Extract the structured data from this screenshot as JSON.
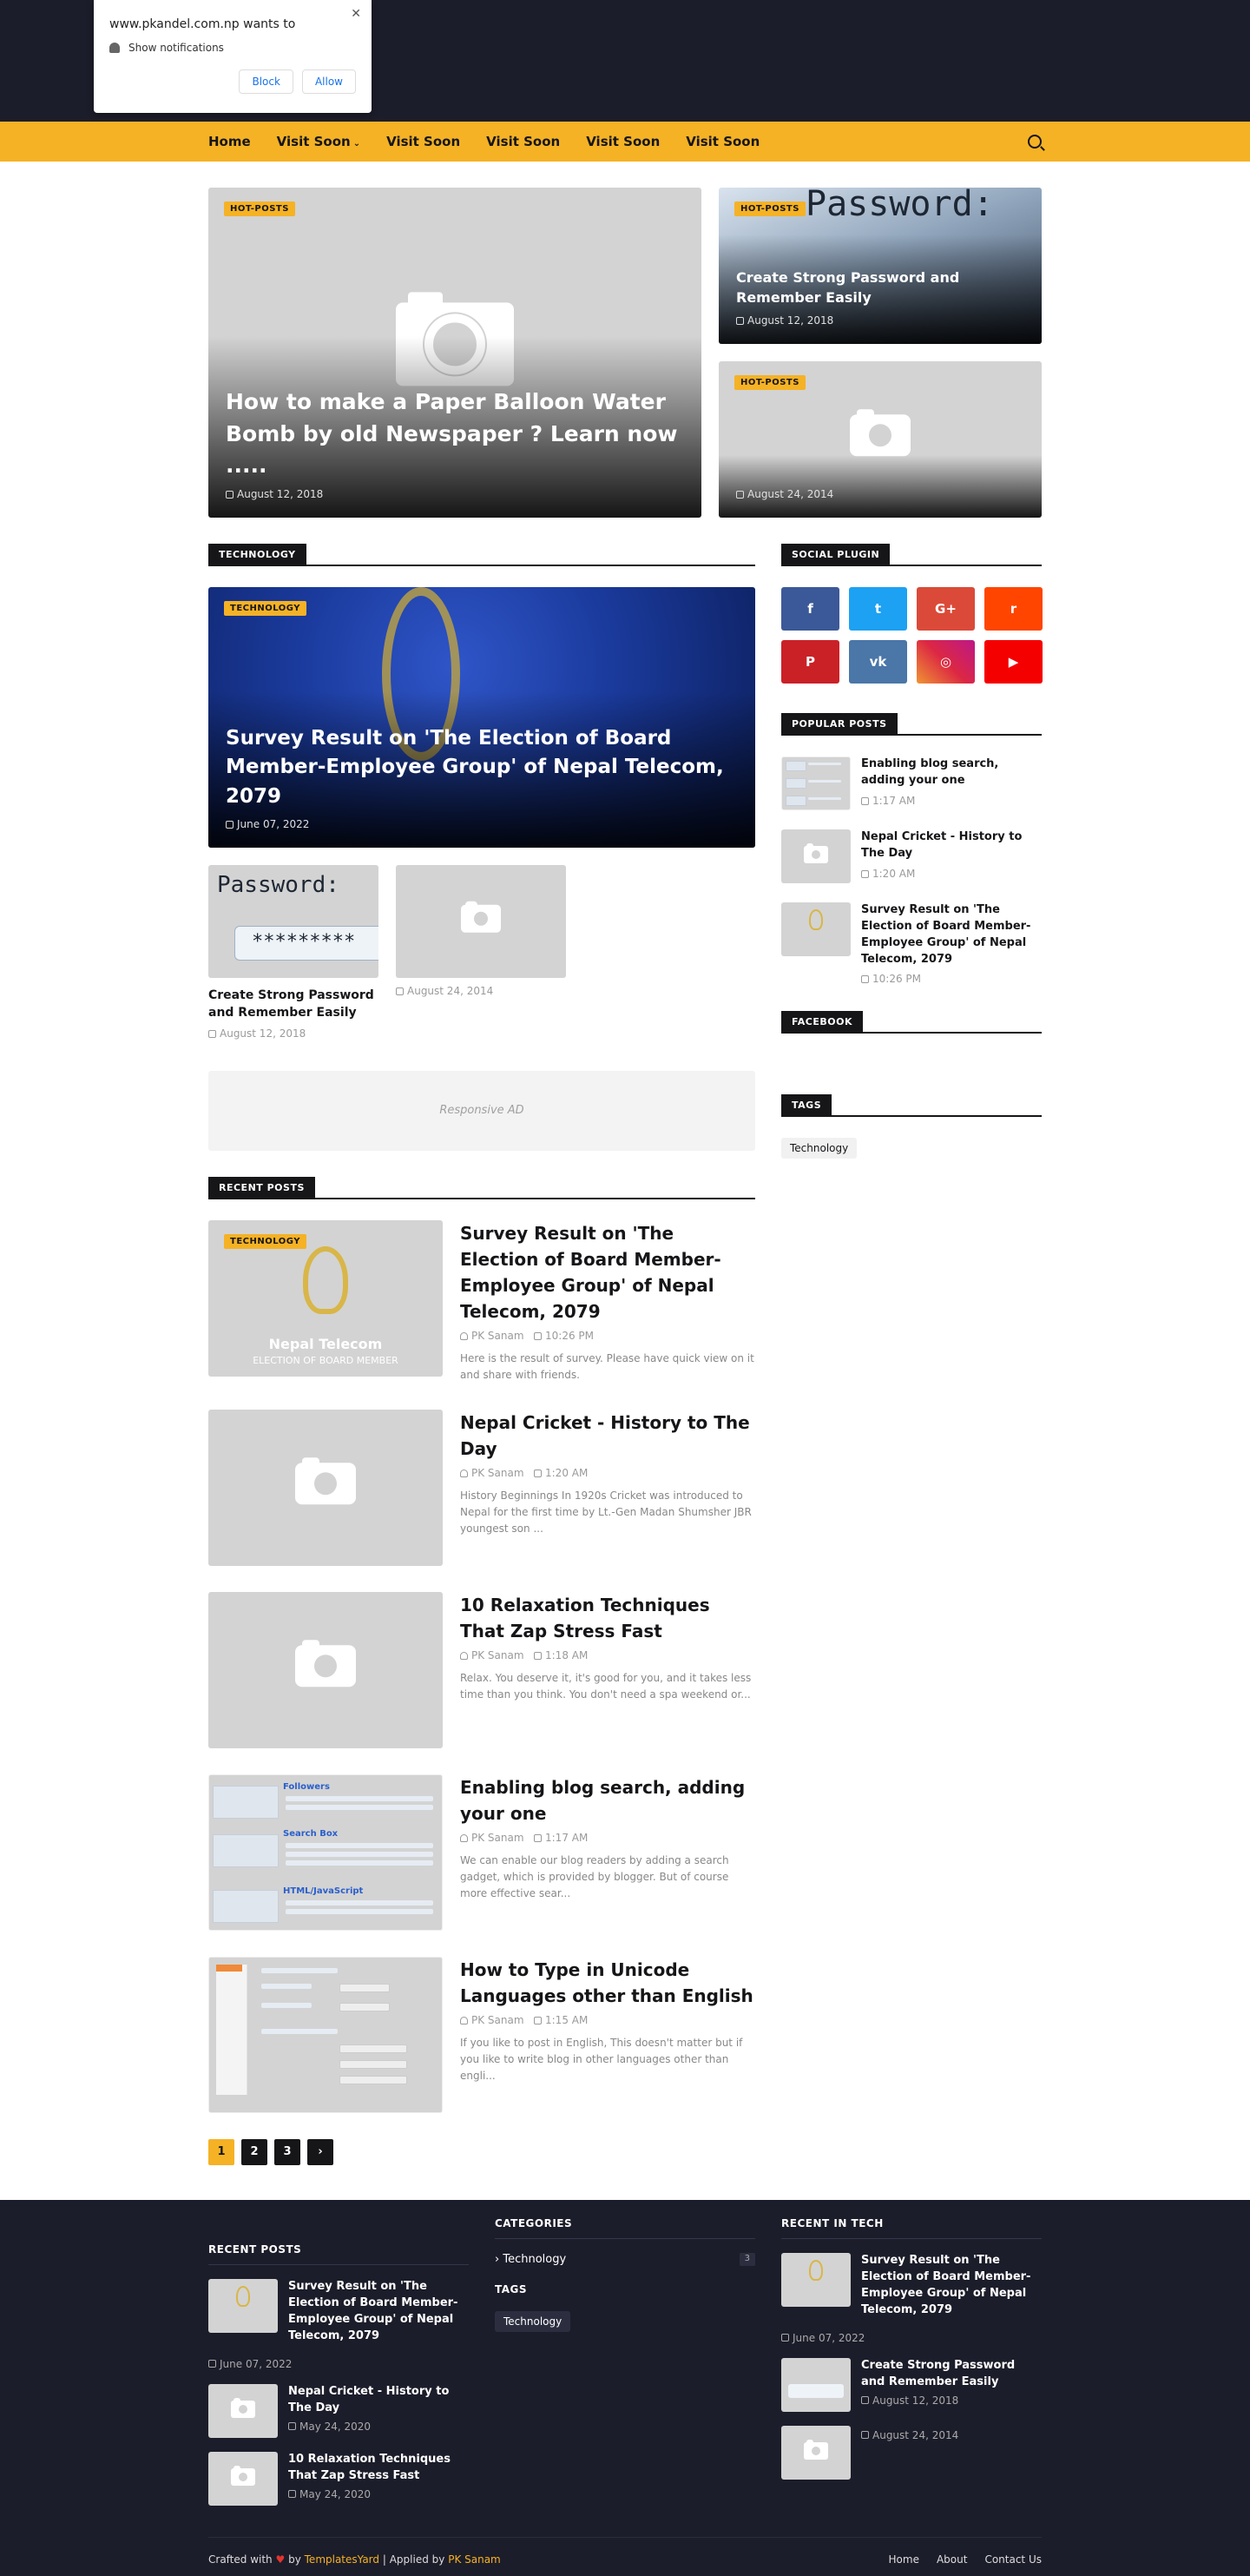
{
  "notification": {
    "site": "www.pkandel.com.np wants to",
    "message": "Show notifications",
    "block": "Block",
    "allow": "Allow"
  },
  "nav": {
    "items": [
      "Home",
      "Visit Soon",
      "Visit Soon",
      "Visit Soon",
      "Visit Soon",
      "Visit Soon"
    ]
  },
  "hot": {
    "badge": "HOT-POSTS",
    "big": {
      "title": "How to make a Paper Balloon Water Bomb by old Newspaper ? Learn now .....",
      "date": "August 12, 2018"
    },
    "small1": {
      "title": "Create Strong Password and Remember Easily",
      "date": "August 12, 2018",
      "bg_text": "Password:"
    },
    "small2": {
      "title": "",
      "date": "August 24, 2014"
    }
  },
  "technology": {
    "section_title": "TECHNOLOGY",
    "badge": "TECHNOLOGY",
    "big": {
      "title": "Survey Result on 'The Election of Board Member-Employee Group' of Nepal Telecom, 2079",
      "date": "June 07, 2022"
    },
    "items": [
      {
        "title": "Create Strong Password and Remember Easily",
        "date": "August 12, 2018",
        "bg_text": "Password:",
        "stars": "*********"
      },
      {
        "title": "",
        "date": "August 24, 2014"
      }
    ]
  },
  "ad": {
    "label": "Responsive AD"
  },
  "recent": {
    "section_title": "RECENT POSTS",
    "badge": "TECHNOLOGY",
    "posts": [
      {
        "title": "Survey Result on 'The Election of Board Member-Employee Group' of Nepal Telecom, 2079",
        "author": "PK Sanam",
        "time": "10:26 PM",
        "excerpt": "Here is the result of survey. Please have quick view on it and share with friends.",
        "thumb_title": "Nepal Telecom",
        "thumb_sub": "ELECTION OF BOARD MEMBER"
      },
      {
        "title": "Nepal Cricket - History to The Day",
        "author": "PK Sanam",
        "time": "1:20 AM",
        "excerpt": "History Beginnings In 1920s Cricket was introduced to Nepal for the first time by Lt.-Gen Madan Shumsher JBR youngest son ..."
      },
      {
        "title": "10 Relaxation Techniques That Zap Stress Fast",
        "author": "PK Sanam",
        "time": "1:18 AM",
        "excerpt": "Relax. You deserve it, it's good for you, and it takes less time than you think. You don't need a spa weekend or..."
      },
      {
        "title": "Enabling blog search, adding your one",
        "author": "PK Sanam",
        "time": "1:17 AM",
        "excerpt": "We can enable our blog readers by adding a search gadget, which is provided by blogger. But of course more effective sear..."
      },
      {
        "title": "How to Type in Unicode Languages other than English",
        "author": "PK Sanam",
        "time": "1:15 AM",
        "excerpt": "If you like to post in English, This doesn't matter but if you like to write blog in other languages other than engli..."
      }
    ],
    "widget_labels": [
      "Followers",
      "Search Box",
      "HTML/JavaScript"
    ]
  },
  "pager": [
    "1",
    "2",
    "3",
    "›"
  ],
  "sidebar": {
    "social_title": "SOCIAL PLUGIN",
    "social": [
      {
        "name": "facebook",
        "glyph": "f",
        "color": "#3b5998"
      },
      {
        "name": "twitter",
        "glyph": "t",
        "color": "#1da1f2"
      },
      {
        "name": "google-plus",
        "glyph": "G+",
        "color": "#db4a39"
      },
      {
        "name": "reddit",
        "glyph": "r",
        "color": "#ff4500"
      },
      {
        "name": "pinterest",
        "glyph": "P",
        "color": "#ca2127"
      },
      {
        "name": "vk",
        "glyph": "vk",
        "color": "#4a76a8"
      },
      {
        "name": "instagram",
        "glyph": "◎",
        "color": "#c13584"
      },
      {
        "name": "youtube",
        "glyph": "▶",
        "color": "#f50000"
      }
    ],
    "popular_title": "POPULAR POSTS",
    "popular": [
      {
        "title": "Enabling blog search, adding your one",
        "time": "1:17 AM"
      },
      {
        "title": "Nepal Cricket - History to The Day",
        "time": "1:20 AM"
      },
      {
        "title": "Survey Result on 'The Election of Board Member-Employee Group' of Nepal Telecom, 2079",
        "time": "10:26 PM"
      }
    ],
    "facebook_title": "FACEBOOK",
    "tags_title": "TAGS",
    "tags": [
      "Technology"
    ]
  },
  "footer": {
    "recent_title": "RECENT POSTS",
    "recent": [
      {
        "title": "Survey Result on 'The Election of Board Member-Employee Group' of Nepal Telecom, 2079",
        "date": "June 07, 2022"
      },
      {
        "title": "Nepal Cricket - History to The Day",
        "date": "May 24, 2020"
      },
      {
        "title": "10 Relaxation Techniques That Zap Stress Fast",
        "date": "May 24, 2020"
      }
    ],
    "categories_title": "CATEGORIES",
    "categories": [
      {
        "name": "Technology",
        "count": "3"
      }
    ],
    "tags_title": "TAGS",
    "tags": [
      "Technology"
    ],
    "tech_title": "RECENT IN TECH",
    "tech": [
      {
        "title": "Survey Result on 'The Election of Board Member-Employee Group' of Nepal Telecom, 2079",
        "date": "June 07, 2022"
      },
      {
        "title": "Create Strong Password and Remember Easily",
        "date": "August 12, 2018"
      },
      {
        "title": "",
        "date": "August 24, 2014"
      }
    ],
    "crafted": "Crafted with",
    "by": "by",
    "templates": "TemplatesYard",
    "applied": "| Applied by",
    "author": "PK Sanam",
    "links": [
      "Home",
      "About",
      "Contact Us"
    ]
  }
}
